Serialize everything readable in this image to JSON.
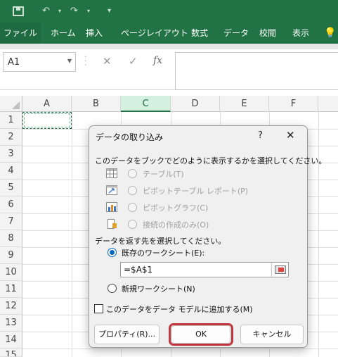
{
  "ribbon": {
    "tabs": [
      "ファイル",
      "ホーム",
      "挿入",
      "ページレイアウト",
      "数式",
      "データ",
      "校閲",
      "表示"
    ]
  },
  "formula_bar": {
    "name_box_value": "A1",
    "fx_label": "fx"
  },
  "grid": {
    "columns": [
      "A",
      "B",
      "C",
      "D",
      "E",
      "F"
    ],
    "rows": [
      "1",
      "2",
      "3",
      "4",
      "5",
      "6",
      "7",
      "8",
      "9",
      "10",
      "11",
      "12",
      "13",
      "14",
      "15"
    ]
  },
  "dialog": {
    "title": "データの取り込み",
    "help": "?",
    "close": "✕",
    "select_display_prompt": "このデータをブックでどのように表示するかを選択してください。",
    "display_options": [
      {
        "label": "テーブル(T)",
        "icon": "table-icon",
        "enabled": false
      },
      {
        "label": "ピボットテーブル レポート(P)",
        "icon": "pivot-table-icon",
        "enabled": false
      },
      {
        "label": "ピボットグラフ(C)",
        "icon": "pivot-chart-icon",
        "enabled": false
      },
      {
        "label": "接続の作成のみ(O)",
        "icon": "connection-icon",
        "enabled": false
      }
    ],
    "destination_prompt": "データを返す先を選択してください。",
    "existing_sheet_label": "既存のワークシート(E):",
    "cell_reference_value": "=$A$1",
    "new_sheet_label": "新規ワークシート(N)",
    "add_to_data_model_label": "このデータをデータ モデルに追加する(M)",
    "properties_button": "プロパティ(R)...",
    "ok_button": "OK",
    "cancel_button": "キャンセル"
  },
  "colors": {
    "excel_green": "#217346",
    "highlight_red": "#c0363c",
    "radio_blue": "#0067c0"
  }
}
